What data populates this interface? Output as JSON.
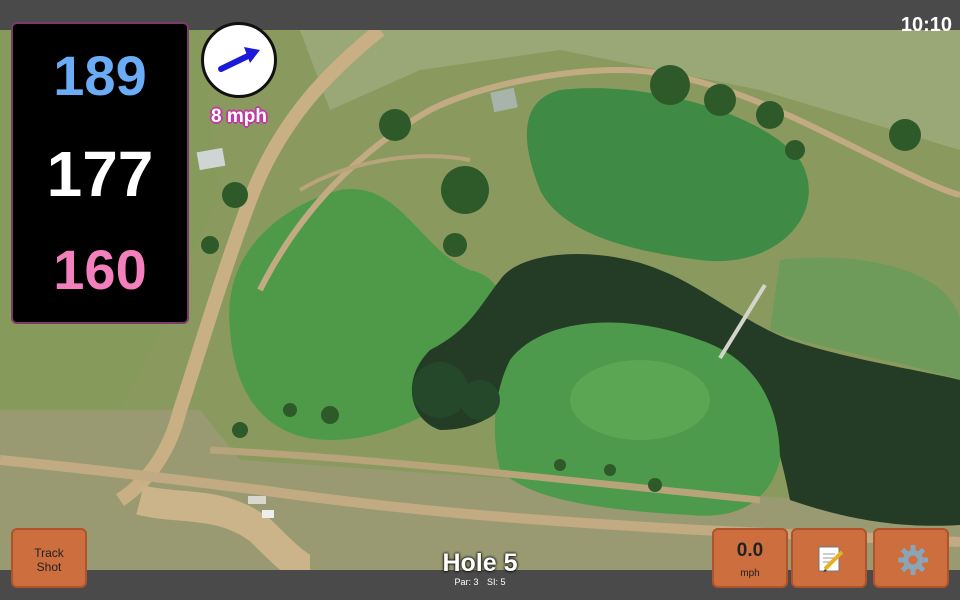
{
  "status": {
    "time": "10:10"
  },
  "distances": {
    "back": "189",
    "middle": "177",
    "front": "160"
  },
  "wind": {
    "speed_label": "8 mph",
    "direction_icon": "wind-arrow-icon"
  },
  "hole": {
    "title": "Hole 5",
    "par_label": "Par: 3",
    "si_label": "SI: 5"
  },
  "buttons": {
    "track_shot_line1": "Track",
    "track_shot_line2": "Shot",
    "speed_value": "0.0",
    "speed_unit": "mph",
    "notes_icon": "notepad-icon",
    "settings_icon": "gear-icon"
  },
  "colors": {
    "back_distance": "#6aacf5",
    "middle_distance": "#ffffff",
    "front_distance": "#f47fbd",
    "button": "#cc6e3e",
    "wind_arrow": "#1a1ad8"
  }
}
